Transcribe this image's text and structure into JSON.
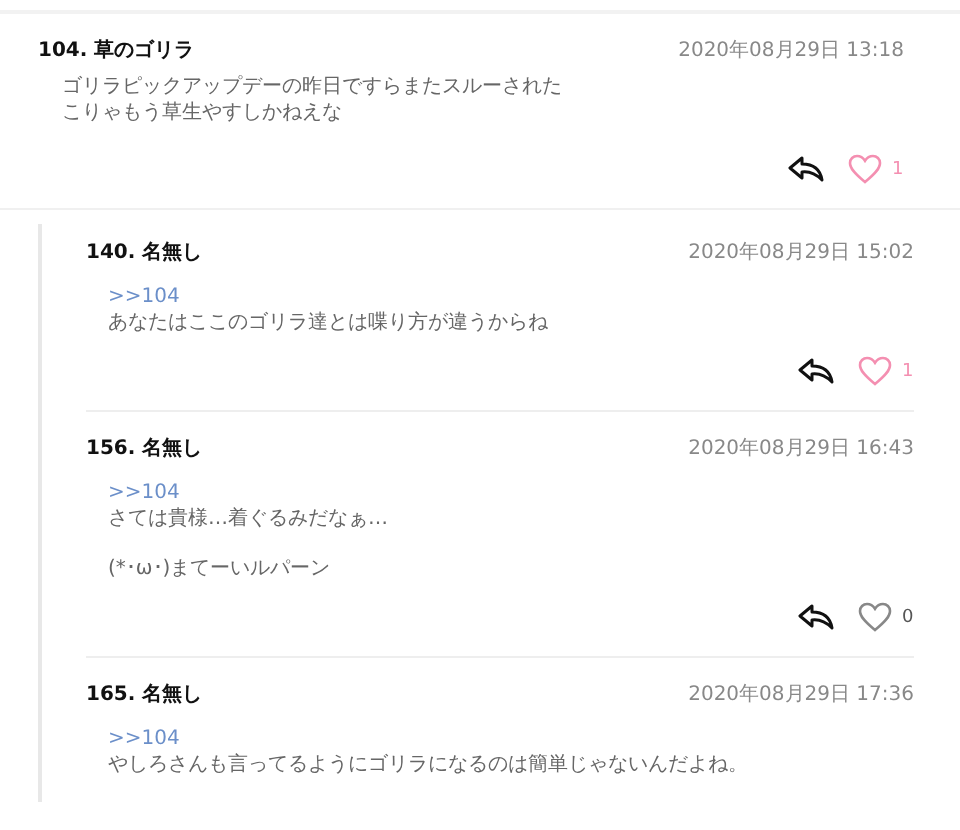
{
  "comment": {
    "number": "104.",
    "name": "草のゴリラ",
    "date": "2020年08月29日 13:18",
    "body": [
      [
        "ゴリラピックアップデーの昨日ですらまたスルーされた",
        "こりゃもう草生やすしかねえな"
      ]
    ],
    "liked": true,
    "like_count": "1"
  },
  "replies": [
    {
      "number": "140.",
      "name": "名無し",
      "date": "2020年08月29日 15:02",
      "ref": ">>104",
      "body": [
        [
          "あなたはここのゴリラ達とは喋り方が違うからね"
        ]
      ],
      "liked": true,
      "like_count": "1"
    },
    {
      "number": "156.",
      "name": "名無し",
      "date": "2020年08月29日 16:43",
      "ref": ">>104",
      "body": [
        [
          "さては貴様…着ぐるみだなぁ…"
        ],
        [
          "(*･ω･)まてーいルパーン"
        ]
      ],
      "liked": false,
      "like_count": "0"
    },
    {
      "number": "165.",
      "name": "名無し",
      "date": "2020年08月29日 17:36",
      "ref": ">>104",
      "body": [
        [
          "やしろさんも言ってるようにゴリラになるのは簡単じゃないんだよね。"
        ]
      ]
    }
  ]
}
